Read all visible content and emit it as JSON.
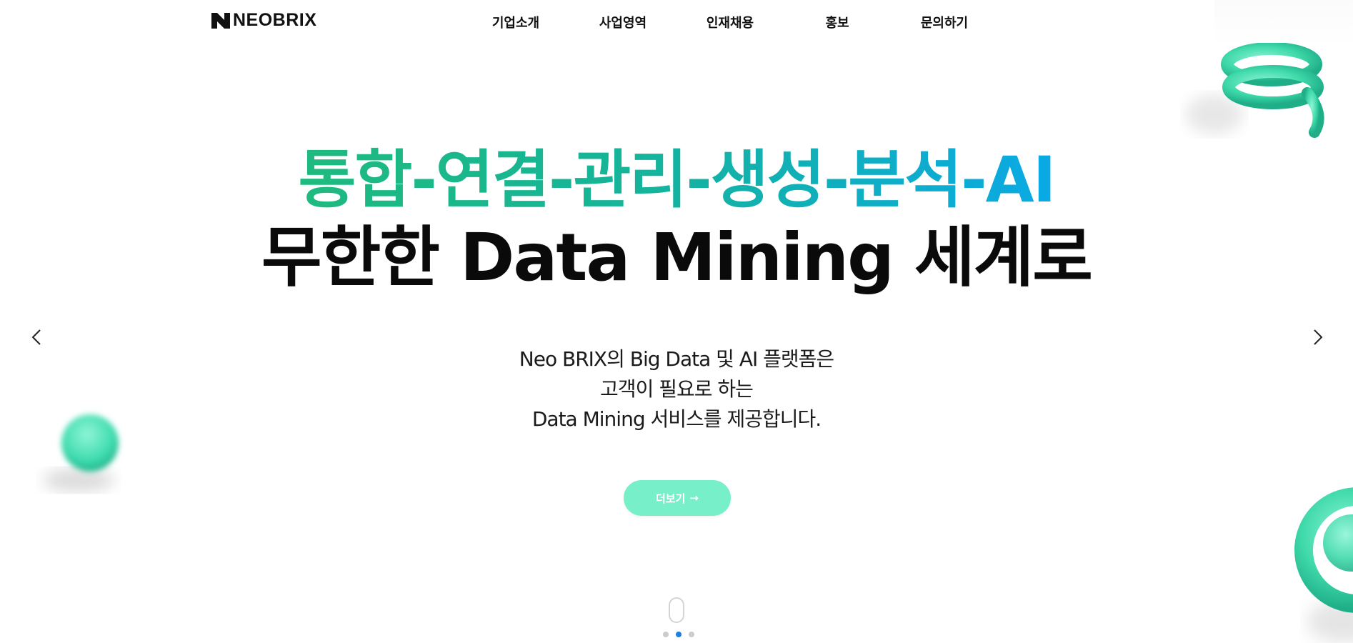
{
  "brand": {
    "name": "NEOBRIX"
  },
  "nav": {
    "items": [
      {
        "label": "기업소개"
      },
      {
        "label": "사업영역"
      },
      {
        "label": "인재채용"
      },
      {
        "label": "홍보"
      },
      {
        "label": "문의하기"
      }
    ]
  },
  "hero": {
    "headline_1": "통합-연결-관리-생성-분석-AI",
    "headline_2": "무한한 Data Mining 세계로",
    "desc_1": "Neo BRIX의 Big Data 및 AI 플랫폼은",
    "desc_2": "고객이 필요로 하는",
    "desc_3": "Data Mining 서비스를 제공합니다.",
    "button_label": "더보기",
    "button_arrow": "→"
  },
  "slider": {
    "prev_icon": "chevron-left-icon",
    "next_icon": "chevron-right-icon",
    "slide_count": 3,
    "active_slide": 2
  },
  "colors": {
    "accent_green": "#1fba7e",
    "accent_blue": "#0aa9e6",
    "button_bg": "#77efc9",
    "dot_active": "#1e7fe0",
    "dot_inactive": "#cccccc"
  }
}
